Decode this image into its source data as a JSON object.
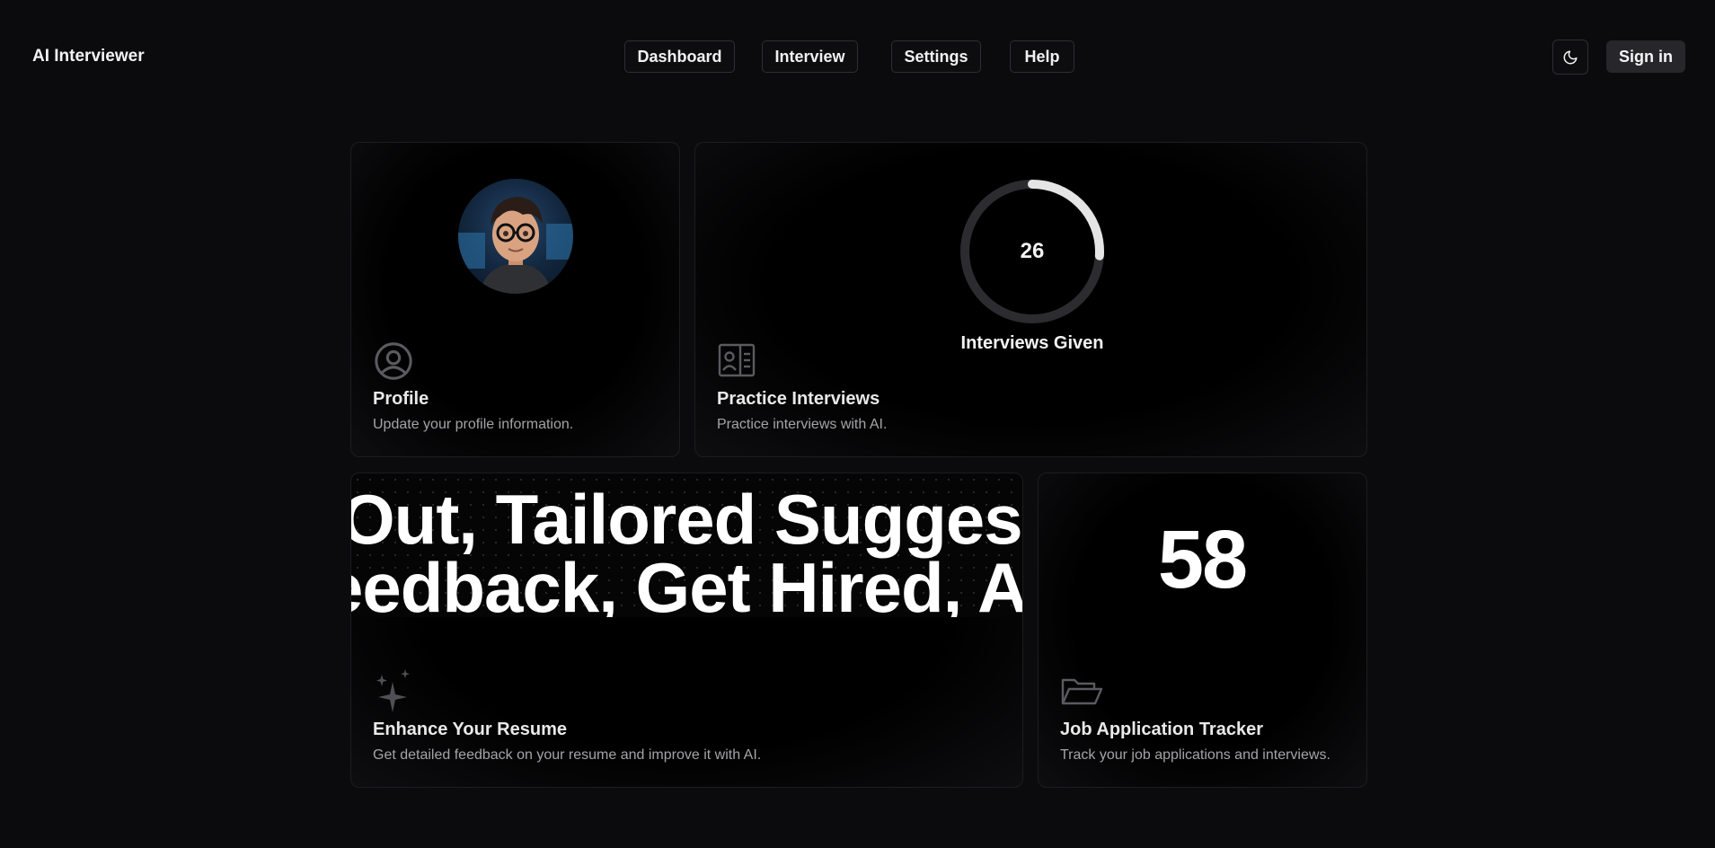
{
  "header": {
    "brand": "AI Interviewer",
    "nav": [
      "Dashboard",
      "Interview",
      "Settings",
      "Help"
    ],
    "sign_in_label": "Sign in",
    "theme_icon": "moon-icon"
  },
  "cards": {
    "profile": {
      "title": "Profile",
      "description": "Update your profile information.",
      "icon": "user-circle-icon"
    },
    "practice": {
      "title": "Practice Interviews",
      "description": "Practice interviews with AI.",
      "icon": "id-card-icon",
      "interviews_given_count": "26",
      "interviews_given_label": "Interviews Given",
      "progress_fraction": 0.26
    },
    "resume": {
      "title": "Enhance Your Resume",
      "description": "Get detailed feedback on your resume and improve it with AI.",
      "icon": "sparkles-icon",
      "marquee_line_1": "Out, Tailored Suggestion",
      "marquee_line_2": "eedback, Get Hired, AI R"
    },
    "tracker": {
      "title": "Job Application Tracker",
      "description": "Track your job applications and interviews.",
      "icon": "folder-open-icon",
      "count": "58"
    }
  },
  "colors": {
    "background": "#0b0b0d",
    "card_border": "#1d1d21",
    "ring_track": "#2c2c30",
    "ring_progress": "#e5e5e5"
  }
}
